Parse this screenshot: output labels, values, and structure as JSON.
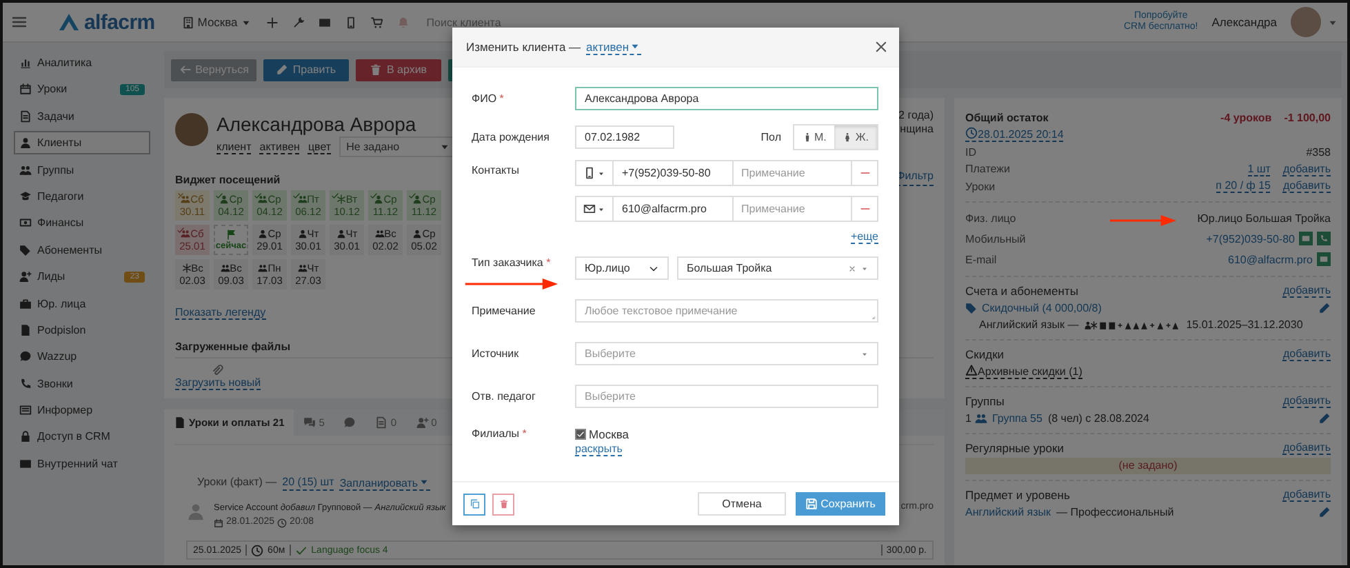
{
  "topbar": {
    "logo": "alfacrm",
    "branch": "Москва",
    "search": {
      "placeholder": "Поиск клиента"
    },
    "promo": [
      "Попробуйте",
      "CRM бесплатно!"
    ],
    "user": "Александра"
  },
  "sidebar": {
    "items": [
      {
        "label": "Аналитика",
        "selected": false
      },
      {
        "label": "Уроки",
        "kind": "info",
        "selected": false,
        "badge": "105"
      },
      {
        "label": "Задачи",
        "selected": false
      },
      {
        "label": "Клиенты",
        "selected": true
      },
      {
        "label": "Группы",
        "selected": false
      },
      {
        "label": "Педагоги",
        "selected": false
      },
      {
        "label": "Финансы",
        "selected": false
      },
      {
        "label": "Абонементы",
        "selected": false
      },
      {
        "label": "Лиды",
        "kind": "warning",
        "selected": false,
        "badge": "23"
      },
      {
        "label": "Юр. лица",
        "selected": false
      },
      {
        "label": "Podpislon",
        "selected": false
      },
      {
        "label": "Wazzup",
        "selected": false
      },
      {
        "label": "Звонки",
        "selected": false
      },
      {
        "label": "Информер",
        "selected": false
      },
      {
        "label": "Доступ в CRM",
        "selected": false
      },
      {
        "label": "Внутренний чат",
        "selected": false
      }
    ]
  },
  "actions": [
    {
      "label": "Вернуться",
      "kind": "back"
    },
    {
      "label": "Править",
      "kind": "edit"
    },
    {
      "label": "В архив",
      "kind": "archive"
    }
  ],
  "client": {
    "name": "Александрова Аврора",
    "tags": [
      "клиент",
      "активен",
      "цвет"
    ],
    "color_select": "Не задано",
    "side_notes": [
      "2 года)",
      "нщина"
    ],
    "filter_link": "Фильтр"
  },
  "visits": {
    "title": "Виджет посещений",
    "legend_link": "Показать легенду",
    "rows": [
      {
        "cells": [
          {
            "kind": "missed",
            "group": true,
            "trial": false,
            "day": "Сб",
            "date": "30.11"
          },
          {
            "kind": "done",
            "group": false,
            "trial": false,
            "day": "Ср",
            "date": "04.12"
          },
          {
            "kind": "done",
            "group": true,
            "trial": false,
            "day": "Ср",
            "date": "04.12"
          },
          {
            "kind": "done",
            "group": true,
            "trial": false,
            "day": "Пт",
            "date": "06.12"
          },
          {
            "kind": "done",
            "trial": true,
            "day": "Вт",
            "date": "10.12"
          },
          {
            "kind": "done",
            "group": false,
            "trial": false,
            "day": "Ср",
            "date": "11.12"
          },
          {
            "kind": "done",
            "group": false,
            "trial": false,
            "day": "Ср",
            "date": "11.12"
          }
        ]
      },
      {
        "cells": [
          {
            "kind": "cancelled",
            "group": true,
            "trial": false,
            "day": "Сб",
            "date": "25.01"
          },
          {
            "kind": "now",
            "label": "сейчас"
          },
          {
            "kind": "planned",
            "group": false,
            "trial": false,
            "day": "Ср",
            "date": "29.01"
          },
          {
            "kind": "planned",
            "group": false,
            "trial": false,
            "day": "Чт",
            "date": "30.01"
          },
          {
            "kind": "planned",
            "group": false,
            "trial": false,
            "day": "Чт",
            "date": "30.01"
          },
          {
            "kind": "planned",
            "group": true,
            "trial": false,
            "day": "Вс",
            "date": "02.02"
          },
          {
            "kind": "planned",
            "group": false,
            "trial": false,
            "day": "Ср",
            "date": "05.02"
          }
        ]
      },
      {
        "cells": [
          {
            "kind": "planned",
            "trial": true,
            "day": "Вс",
            "date": "02.03"
          },
          {
            "kind": "planned",
            "group": true,
            "trial": false,
            "day": "Вс",
            "date": "09.03"
          },
          {
            "kind": "planned",
            "group": true,
            "trial": false,
            "day": "Пн",
            "date": "17.03"
          },
          {
            "kind": "planned",
            "group": true,
            "trial": false,
            "day": "Чт",
            "date": "27.03"
          }
        ]
      }
    ]
  },
  "files": {
    "title": "Загруженные файлы",
    "upload_link": "Загрузить новый"
  },
  "tabs": [
    {
      "label": "Уроки и оплаты 21",
      "kind": "lessons",
      "selected": true
    },
    {
      "label": "5",
      "kind": "comments",
      "selected": false
    },
    {
      "kind": "chat",
      "selected": false
    },
    {
      "label": "0",
      "kind": "documents",
      "selected": false
    },
    {
      "label": "0",
      "kind": "tasks",
      "selected": false
    }
  ],
  "lessons": {
    "summary": "Уроки (факт) —",
    "count_link": "20 (15) шт",
    "plan_link": "Запланировать",
    "entries": [
      {
        "text": "Service Account *добавил* Групповой — *Английский язык*",
        "date": "28.01.2025",
        "time": "20:08",
        "fragment": "crm.pro",
        "line": {
          "date": "25.01.2025",
          "duration": "60м",
          "topic": "Language focus 4",
          "price": "300,00 р."
        }
      }
    ]
  },
  "summary": {
    "title": "Общий остаток",
    "lessons_balance": "-4 уроков",
    "money_balance": "-1 100,00",
    "updated": "28.01.2025 20:14",
    "rows": [
      {
        "label": "ID",
        "value": "#358"
      },
      {
        "label": "Платежи",
        "link": "1 шт",
        "action": "добавить"
      },
      {
        "label": "Уроки",
        "link": "п 20 / ф 15",
        "action": "добавить"
      }
    ]
  },
  "contacts": [
    {
      "label": "Физ. лицо",
      "kind": "text",
      "value": "Юр.лицо Большая Тройка"
    },
    {
      "label": "Мобильный",
      "kind": "phone",
      "value": "+7(952)039-50-80"
    },
    {
      "label": "E-mail",
      "kind": "email",
      "value": "610@alfacrm.pro"
    }
  ],
  "sections": [
    {
      "kind": "subscriptions",
      "title": "Счета и абонементы",
      "action": "добавить",
      "link": "Скидочный (4 000,00/8)",
      "subject": "Английский язык —",
      "period": "15.01.2025–31.12.2030"
    },
    {
      "kind": "discounts",
      "title": "Скидки",
      "action": "добавить",
      "link": "Архивные скидки (1)"
    },
    {
      "kind": "groups",
      "title": "Группы",
      "action": "добавить",
      "index": "1",
      "link": "Группа 55",
      "details": "(8 чел) с 28.08.2024"
    },
    {
      "kind": "regular",
      "title": "Регулярные уроки",
      "action": "добавить",
      "empty": "(не задано)"
    },
    {
      "kind": "subject",
      "title": "Предмет и уровень",
      "action": "добавить",
      "link": "Английский язык",
      "details": "— Профессиональный"
    }
  ],
  "modal": {
    "title": "Изменить клиента —",
    "status_link": "активен",
    "full_name": {
      "label": "ФИО",
      "mark": "*",
      "value": "Александрова Аврора"
    },
    "birth_date": {
      "label": "Дата рождения",
      "value": "07.02.1982"
    },
    "gender": {
      "label": "Пол",
      "options": [
        {
          "kind": "male",
          "label": "М.",
          "selected": false
        },
        {
          "kind": "female",
          "label": "Ж.",
          "selected": true
        }
      ]
    },
    "contacts": {
      "label": "Контакты",
      "more_link": "+еще",
      "items": [
        {
          "kind": "phone",
          "value": "+7(952)039-50-80",
          "note_placeholder": "Примечание"
        },
        {
          "kind": "email",
          "value": "610@alfacrm.pro",
          "note_placeholder": "Примечание"
        }
      ]
    },
    "customer_type": {
      "label": "Тип заказчика",
      "mark": "*",
      "value": "Юр.лицо",
      "company": "Большая Тройка"
    },
    "note": {
      "label": "Примечание",
      "placeholder": "Любое текстовое примечание"
    },
    "source": {
      "label": "Источник",
      "placeholder": "Выберите"
    },
    "teacher": {
      "label": "Отв. педагог",
      "placeholder": "Выберите"
    },
    "branches": {
      "label": "Филиалы",
      "mark": "*",
      "expand_link": "раскрыть",
      "items": [
        {
          "label": "Москва",
          "checked": true
        }
      ]
    },
    "buttons": {
      "cancel": "Отмена",
      "save": "Сохранить"
    }
  }
}
